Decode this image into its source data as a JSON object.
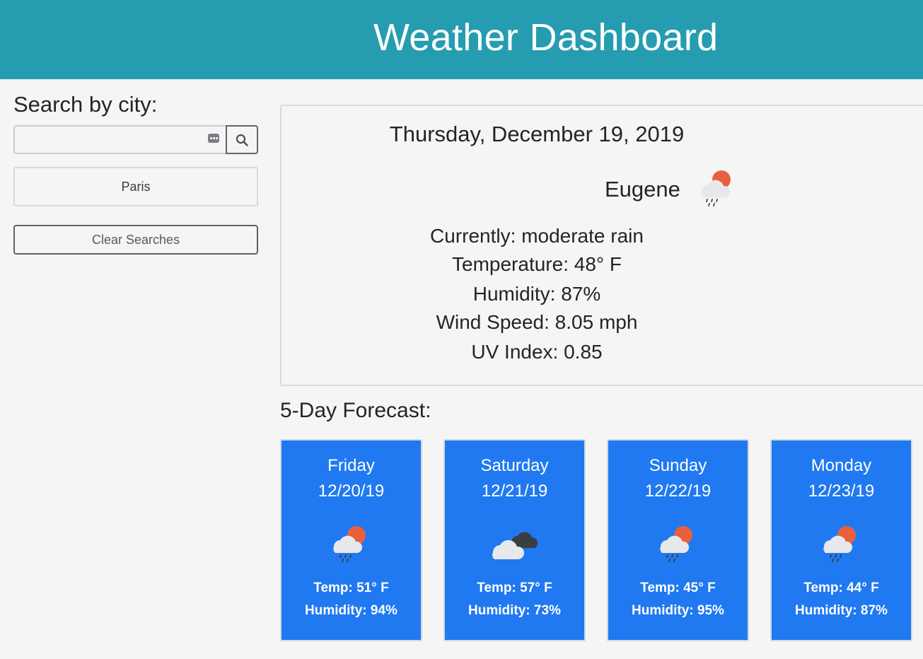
{
  "header": {
    "title": "Weather Dashboard"
  },
  "sidebar": {
    "search_label": "Search by city:",
    "search_value": "",
    "search_button_icon": "search-icon",
    "history": [
      "Paris"
    ],
    "clear_label": "Clear Searches"
  },
  "current": {
    "date": "Thursday, December 19, 2019",
    "city": "Eugene",
    "icon": "rain-cloud-sun-icon",
    "conditions": "Currently: moderate rain",
    "temperature": "Temperature: 48° F",
    "humidity": "Humidity: 87%",
    "wind": "Wind Speed: 8.05 mph",
    "uv": "UV Index: 0.85"
  },
  "forecast": {
    "title": "5-Day Forecast:",
    "days": [
      {
        "day": "Friday",
        "date": "12/20/19",
        "icon": "rain-cloud-sun-icon",
        "temp": "Temp: 51° F",
        "humidity": "Humidity: 94%"
      },
      {
        "day": "Saturday",
        "date": "12/21/19",
        "icon": "broken-clouds-icon",
        "temp": "Temp: 57° F",
        "humidity": "Humidity: 73%"
      },
      {
        "day": "Sunday",
        "date": "12/22/19",
        "icon": "rain-cloud-sun-icon",
        "temp": "Temp: 45° F",
        "humidity": "Humidity: 95%"
      },
      {
        "day": "Monday",
        "date": "12/23/19",
        "icon": "rain-cloud-sun-icon",
        "temp": "Temp: 44° F",
        "humidity": "Humidity: 87%"
      }
    ]
  },
  "colors": {
    "header": "#269cb0",
    "forecast_card": "#2079f0",
    "background": "#f5f5f5"
  }
}
